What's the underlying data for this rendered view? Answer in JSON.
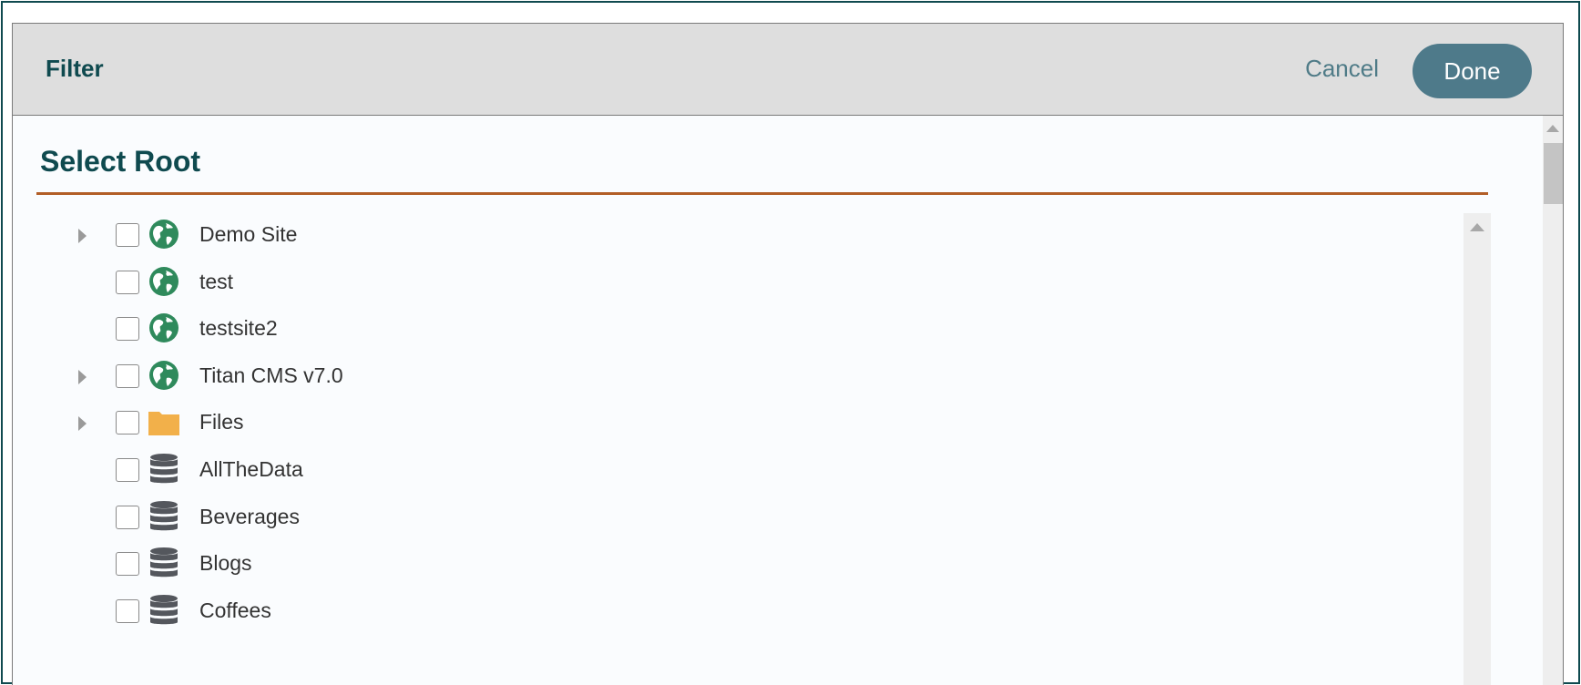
{
  "dialog": {
    "title": "Filter",
    "cancel_label": "Cancel",
    "done_label": "Done"
  },
  "section": {
    "title": "Select Root"
  },
  "tree": {
    "items": [
      {
        "label": "Demo Site",
        "icon": "globe-icon",
        "expandable": true,
        "checked": false
      },
      {
        "label": "test",
        "icon": "globe-icon",
        "expandable": false,
        "checked": false
      },
      {
        "label": "testsite2",
        "icon": "globe-icon",
        "expandable": false,
        "checked": false
      },
      {
        "label": "Titan CMS v7.0",
        "icon": "globe-icon",
        "expandable": true,
        "checked": false
      },
      {
        "label": "Files",
        "icon": "folder-icon",
        "expandable": true,
        "checked": false
      },
      {
        "label": "AllTheData",
        "icon": "database-icon",
        "expandable": false,
        "checked": false
      },
      {
        "label": "Beverages",
        "icon": "database-icon",
        "expandable": false,
        "checked": false
      },
      {
        "label": "Blogs",
        "icon": "database-icon",
        "expandable": false,
        "checked": false
      },
      {
        "label": "Coffees",
        "icon": "database-icon",
        "expandable": false,
        "checked": false
      }
    ]
  },
  "colors": {
    "primary": "#0f4a4f",
    "accent_rule": "#b25e27",
    "done_button": "#4e7a8a",
    "globe": "#2f8a5c",
    "folder": "#f2b04a",
    "database": "#54575d"
  }
}
